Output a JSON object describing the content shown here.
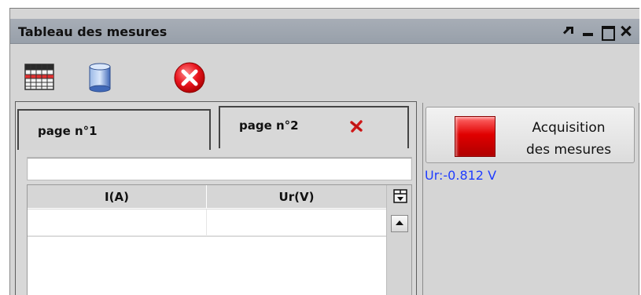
{
  "window": {
    "title": "Tableau des mesures",
    "controls": [
      "pin-icon",
      "minimize-icon",
      "maximize-icon",
      "close-icon"
    ]
  },
  "toolbar": {
    "buttons": [
      {
        "name": "table-button",
        "icon": "table-grid-icon"
      },
      {
        "name": "database-button",
        "icon": "database-cylinder-icon"
      },
      {
        "name": "stop-button",
        "icon": "red-x-circle-icon"
      }
    ]
  },
  "tabs": [
    {
      "label": "page n°1",
      "active": false
    },
    {
      "label": "page n°2",
      "active": true,
      "closable": true
    }
  ],
  "filter": {
    "value": ""
  },
  "table": {
    "columns": [
      "I(A)",
      "Ur(V)"
    ],
    "rows": [
      [
        "",
        ""
      ]
    ]
  },
  "acquisition": {
    "label_line1": "Acquisition",
    "label_line2": "des mesures"
  },
  "readout": {
    "text": "Ur:-0.812 V"
  },
  "colors": {
    "titlebar": "#9aa1ab",
    "readout": "#1f3cff",
    "acq_icon": "#e00000"
  }
}
